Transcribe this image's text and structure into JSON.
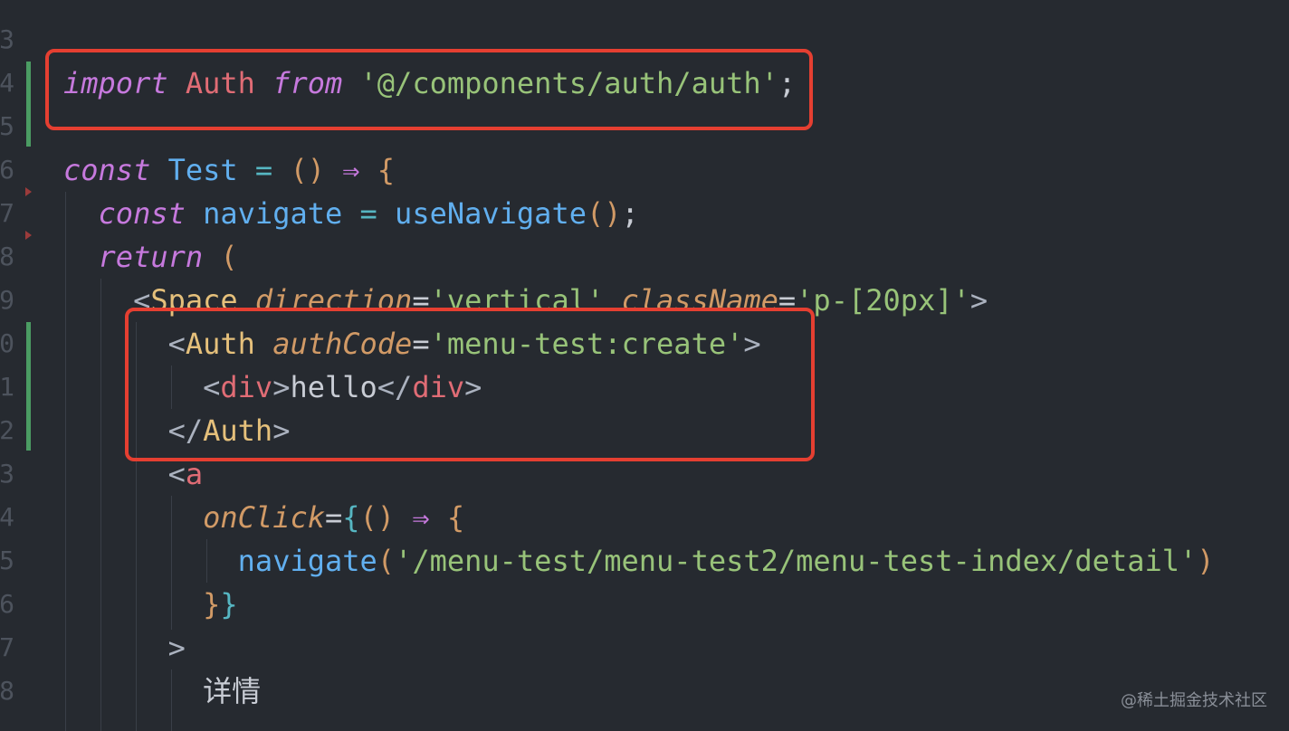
{
  "editor": {
    "lines": [
      {
        "num": "3",
        "segments": []
      },
      {
        "num": "4",
        "segments": [
          {
            "t": "import",
            "c": "kw"
          },
          {
            "t": " ",
            "c": "punc"
          },
          {
            "t": "Auth",
            "c": "id"
          },
          {
            "t": " ",
            "c": "punc"
          },
          {
            "t": "from",
            "c": "kw"
          },
          {
            "t": " ",
            "c": "punc"
          },
          {
            "t": "'@/components/auth/auth'",
            "c": "str"
          },
          {
            "t": ";",
            "c": "punc"
          }
        ]
      },
      {
        "num": "5",
        "segments": []
      },
      {
        "num": "6",
        "segments": [
          {
            "t": "const",
            "c": "kw"
          },
          {
            "t": " ",
            "c": "punc"
          },
          {
            "t": "Test",
            "c": "tname"
          },
          {
            "t": " ",
            "c": "punc"
          },
          {
            "t": "=",
            "c": "op"
          },
          {
            "t": " ",
            "c": "punc"
          },
          {
            "t": "()",
            "c": "paren"
          },
          {
            "t": " ",
            "c": "punc"
          },
          {
            "t": "⇒",
            "c": "kw"
          },
          {
            "t": " ",
            "c": "punc"
          },
          {
            "t": "{",
            "c": "brace"
          }
        ]
      },
      {
        "num": "7",
        "segments": [
          {
            "t": "  ",
            "c": "punc"
          },
          {
            "t": "const",
            "c": "kw"
          },
          {
            "t": " ",
            "c": "punc"
          },
          {
            "t": "navigate",
            "c": "tname"
          },
          {
            "t": " ",
            "c": "punc"
          },
          {
            "t": "=",
            "c": "op"
          },
          {
            "t": " ",
            "c": "punc"
          },
          {
            "t": "useNavigate",
            "c": "fn"
          },
          {
            "t": "()",
            "c": "paren"
          },
          {
            "t": ";",
            "c": "punc"
          }
        ]
      },
      {
        "num": "8",
        "segments": [
          {
            "t": "  ",
            "c": "punc"
          },
          {
            "t": "return",
            "c": "kw"
          },
          {
            "t": " ",
            "c": "punc"
          },
          {
            "t": "(",
            "c": "paren"
          }
        ]
      },
      {
        "num": "9",
        "segments": [
          {
            "t": "    ",
            "c": "punc"
          },
          {
            "t": "<",
            "c": "angle"
          },
          {
            "t": "Space",
            "c": "tag"
          },
          {
            "t": " ",
            "c": "punc"
          },
          {
            "t": "direction",
            "c": "attr"
          },
          {
            "t": "=",
            "c": "punc"
          },
          {
            "t": "'vertical'",
            "c": "str"
          },
          {
            "t": " ",
            "c": "punc"
          },
          {
            "t": "className",
            "c": "attr"
          },
          {
            "t": "=",
            "c": "punc"
          },
          {
            "t": "'p-[20px]'",
            "c": "str"
          },
          {
            "t": ">",
            "c": "angle"
          }
        ]
      },
      {
        "num": "0",
        "segments": [
          {
            "t": "      ",
            "c": "punc"
          },
          {
            "t": "<",
            "c": "angle"
          },
          {
            "t": "Auth",
            "c": "tag"
          },
          {
            "t": " ",
            "c": "punc"
          },
          {
            "t": "authCode",
            "c": "attr"
          },
          {
            "t": "=",
            "c": "punc"
          },
          {
            "t": "'menu-test:create'",
            "c": "str"
          },
          {
            "t": ">",
            "c": "angle"
          }
        ]
      },
      {
        "num": "1",
        "segments": [
          {
            "t": "        ",
            "c": "punc"
          },
          {
            "t": "<",
            "c": "angle"
          },
          {
            "t": "div",
            "c": "htmltag"
          },
          {
            "t": ">",
            "c": "angle"
          },
          {
            "t": "hello",
            "c": "txt"
          },
          {
            "t": "</",
            "c": "angle"
          },
          {
            "t": "div",
            "c": "htmltag"
          },
          {
            "t": ">",
            "c": "angle"
          }
        ]
      },
      {
        "num": "2",
        "segments": [
          {
            "t": "      ",
            "c": "punc"
          },
          {
            "t": "</",
            "c": "angle"
          },
          {
            "t": "Auth",
            "c": "tag"
          },
          {
            "t": ">",
            "c": "angle"
          }
        ]
      },
      {
        "num": "3",
        "segments": [
          {
            "t": "      ",
            "c": "punc"
          },
          {
            "t": "<",
            "c": "angle"
          },
          {
            "t": "a",
            "c": "htmltag"
          }
        ]
      },
      {
        "num": "4",
        "segments": [
          {
            "t": "        ",
            "c": "punc"
          },
          {
            "t": "onClick",
            "c": "attr"
          },
          {
            "t": "=",
            "c": "punc"
          },
          {
            "t": "{",
            "c": "op"
          },
          {
            "t": "()",
            "c": "paren"
          },
          {
            "t": " ",
            "c": "punc"
          },
          {
            "t": "⇒",
            "c": "kw"
          },
          {
            "t": " ",
            "c": "punc"
          },
          {
            "t": "{",
            "c": "brace"
          }
        ]
      },
      {
        "num": "5",
        "segments": [
          {
            "t": "          ",
            "c": "punc"
          },
          {
            "t": "navigate",
            "c": "fn"
          },
          {
            "t": "(",
            "c": "paren"
          },
          {
            "t": "'/menu-test/menu-test2/menu-test-index/detail'",
            "c": "str"
          },
          {
            "t": ")",
            "c": "paren"
          }
        ]
      },
      {
        "num": "6",
        "segments": [
          {
            "t": "        ",
            "c": "punc"
          },
          {
            "t": "}",
            "c": "brace"
          },
          {
            "t": "}",
            "c": "op"
          }
        ]
      },
      {
        "num": "7",
        "segments": [
          {
            "t": "      ",
            "c": "punc"
          },
          {
            "t": ">",
            "c": "angle"
          }
        ]
      },
      {
        "num": "8",
        "segments": [
          {
            "t": "        ",
            "c": "punc"
          },
          {
            "t": "详情",
            "c": "txt cjk"
          }
        ]
      }
    ]
  },
  "watermark": "@稀土掘金技术社区",
  "colors": {
    "background": "#262a30",
    "highlight_border": "#e53f31",
    "change_bar": "#4b9c63"
  }
}
